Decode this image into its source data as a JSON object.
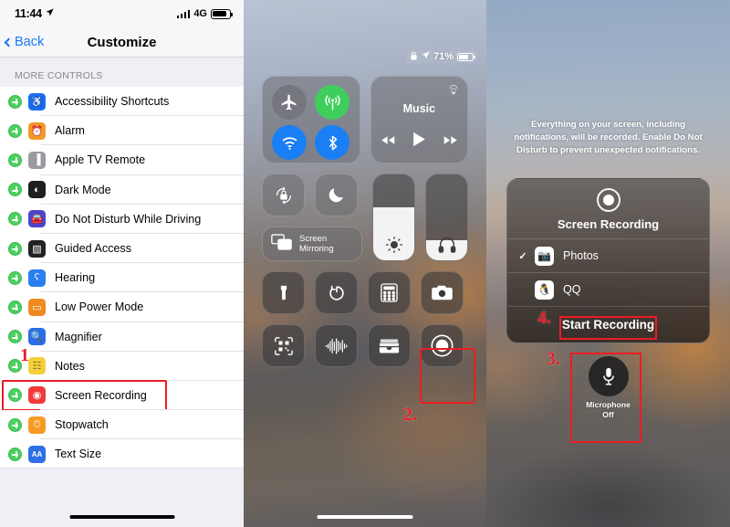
{
  "settings_panel": {
    "status_bar": {
      "time": "11:44",
      "location_icon": "location-arrow-icon",
      "network": "4G",
      "signal_icon": "signal-bars-icon",
      "battery_icon": "battery-icon"
    },
    "nav": {
      "back_label": "Back",
      "title": "Customize",
      "back_icon": "chevron-left-icon"
    },
    "section_header": "MORE CONTROLS",
    "items": [
      {
        "label": "Accessibility Shortcuts",
        "icon": "accessibility-icon",
        "icon_bg": "#1a6ff0",
        "glyph": "♿",
        "add_icon": "add-plus-icon"
      },
      {
        "label": "Alarm",
        "icon": "alarm-clock-icon",
        "icon_bg": "#f09a28",
        "glyph": "⏰",
        "add_icon": "add-plus-icon"
      },
      {
        "label": "Apple TV Remote",
        "icon": "apple-tv-remote-icon",
        "icon_bg": "#9a9a9f",
        "glyph": "▐",
        "add_icon": "add-plus-icon"
      },
      {
        "label": "Dark Mode",
        "icon": "dark-mode-icon",
        "icon_bg": "#1f1f22",
        "glyph": "◐",
        "add_icon": "add-plus-icon"
      },
      {
        "label": "Do Not Disturb While Driving",
        "icon": "car-icon",
        "icon_bg": "#4a45c9",
        "glyph": "🚘",
        "add_icon": "add-plus-icon"
      },
      {
        "label": "Guided Access",
        "icon": "guided-access-icon",
        "icon_bg": "#222225",
        "glyph": "▧",
        "add_icon": "add-plus-icon"
      },
      {
        "label": "Hearing",
        "icon": "hearing-icon",
        "icon_bg": "#2a7ef0",
        "glyph": "ʕ",
        "add_icon": "add-plus-icon"
      },
      {
        "label": "Low Power Mode",
        "icon": "low-power-icon",
        "icon_bg": "#f08a20",
        "glyph": "▭",
        "add_icon": "add-plus-icon"
      },
      {
        "label": "Magnifier",
        "icon": "magnifier-icon",
        "icon_bg": "#2b6ee8",
        "glyph": "🔍",
        "add_icon": "add-plus-icon"
      },
      {
        "label": "Notes",
        "icon": "notes-icon",
        "icon_bg": "#f3cf3c",
        "glyph": "☷",
        "add_icon": "add-plus-icon"
      },
      {
        "label": "Screen Recording",
        "icon": "screen-recording-icon",
        "icon_bg": "#ef3b3b",
        "glyph": "◉",
        "add_icon": "add-plus-icon"
      },
      {
        "label": "Stopwatch",
        "icon": "stopwatch-icon",
        "icon_bg": "#f59b24",
        "glyph": "⏱",
        "add_icon": "add-plus-icon"
      },
      {
        "label": "Text Size",
        "icon": "text-size-icon",
        "icon_bg": "#2f6fe4",
        "glyph": "AA",
        "add_icon": "add-plus-icon"
      }
    ],
    "highlighted_item": "Screen Recording",
    "marker": "1"
  },
  "control_center_panel": {
    "status": {
      "battery_percent": "71%",
      "lock_icon": "orientation-lock-icon",
      "location_icon": "location-arrow-icon",
      "battery_icon": "battery-icon"
    },
    "connectivity": [
      {
        "name": "airplane-mode-toggle",
        "icon": "airplane-icon",
        "glyph": "✈",
        "color": "#76767e",
        "state": "off"
      },
      {
        "name": "cellular-data-toggle",
        "icon": "cellular-antenna-icon",
        "glyph": "\u0001",
        "color": "#3ece5c",
        "state": "on"
      },
      {
        "name": "wifi-toggle",
        "icon": "wifi-icon",
        "glyph": "\u0002",
        "color": "#1a7ef5",
        "state": "on"
      },
      {
        "name": "bluetooth-toggle",
        "icon": "bluetooth-icon",
        "glyph": "\u0003",
        "color": "#1a7ef5",
        "state": "on"
      }
    ],
    "media": {
      "title": "Music",
      "airplay_icon": "airplay-audio-icon",
      "prev_icon": "rewind-icon",
      "play_icon": "play-icon",
      "next_icon": "fast-forward-icon"
    },
    "rotation_lock": {
      "icon": "rotation-lock-icon"
    },
    "do_not_disturb": {
      "icon": "moon-icon"
    },
    "screen_mirroring": {
      "label_line1": "Screen",
      "label_line2": "Mirroring",
      "icon": "screen-mirroring-icon"
    },
    "brightness": {
      "icon": "brightness-sun-icon",
      "level": 62
    },
    "volume": {
      "icon": "headphones-icon",
      "level": 23
    },
    "shortcuts": [
      {
        "name": "flashlight-button",
        "icon": "flashlight-icon"
      },
      {
        "name": "timer-button",
        "icon": "timer-icon"
      },
      {
        "name": "calculator-button",
        "icon": "calculator-icon"
      },
      {
        "name": "camera-button",
        "icon": "camera-icon"
      },
      {
        "name": "code-scanner-button",
        "icon": "qr-code-scanner-icon"
      },
      {
        "name": "sound-recognition-button",
        "icon": "sound-waveform-icon"
      },
      {
        "name": "wallet-button",
        "icon": "wallet-icon"
      },
      {
        "name": "screen-recording-button",
        "icon": "screen-record-icon"
      }
    ],
    "marker": "2."
  },
  "recording_sheet_panel": {
    "warning": "Everything on your screen, including notifications, will be recorded. Enable Do Not Disturb to prevent unexpected notifications.",
    "sheet": {
      "title": "Screen Recording",
      "record_icon": "record-ring-icon",
      "destinations": [
        {
          "label": "Photos",
          "icon": "photos-camera-icon",
          "selected": true,
          "check_icon": "checkmark-icon",
          "glyph": "📷"
        },
        {
          "label": "QQ",
          "icon": "qq-penguin-icon",
          "selected": false,
          "check_icon": "",
          "glyph": "🐧"
        }
      ],
      "action_label": "Start Recording"
    },
    "microphone": {
      "label_line1": "Microphone",
      "label_line2": "Off",
      "icon": "microphone-icon",
      "state": "off"
    },
    "markers": {
      "microphone": "3.",
      "start_recording": "4."
    }
  },
  "colors": {
    "annotation": "#ec1c24",
    "accent_blue": "#1578f2",
    "add_green": "#4cd060"
  }
}
